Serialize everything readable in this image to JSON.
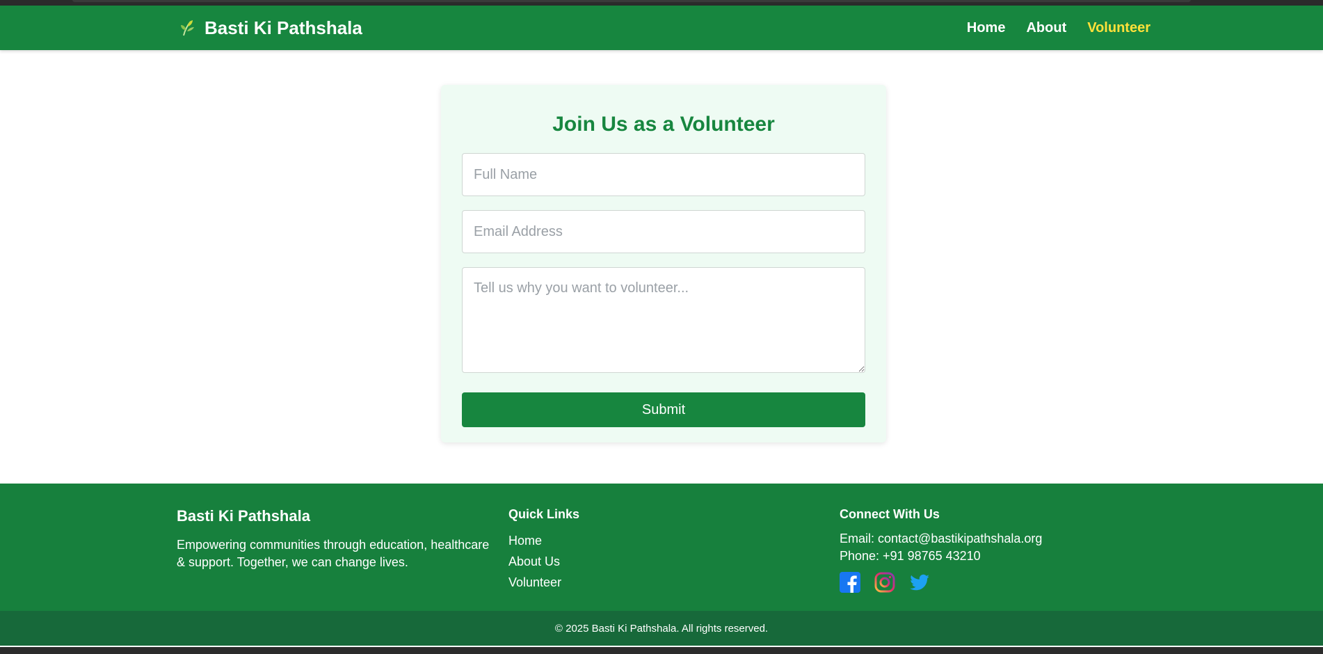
{
  "brand": {
    "name": "Basti Ki Pathshala",
    "icon": "leaf-icon"
  },
  "nav": {
    "items": [
      {
        "label": "Home"
      },
      {
        "label": "About"
      },
      {
        "label": "Volunteer"
      }
    ],
    "active": "Volunteer",
    "active_color": "#ffe13a"
  },
  "form": {
    "title": "Join Us as a Volunteer",
    "name_placeholder": "Full Name",
    "email_placeholder": "Email Address",
    "message_placeholder": "Tell us why you want to volunteer...",
    "submit_label": "Submit"
  },
  "footer": {
    "brand": "Basti Ki Pathshala",
    "description": "Empowering communities through education, healthcare & support. Together, we can change lives.",
    "quick_links_heading": "Quick Links",
    "quick_links": [
      {
        "label": "Home"
      },
      {
        "label": "About Us"
      },
      {
        "label": "Volunteer"
      }
    ],
    "connect_heading": "Connect With Us",
    "email_line": "Email: contact@bastikipathshala.org",
    "phone_line": "Phone: +91 98765 43210",
    "socials": [
      "facebook-icon",
      "instagram-icon",
      "twitter-icon"
    ],
    "copyright": "© 2025 Basti Ki Pathshala. All rights reserved."
  },
  "colors": {
    "primary_green": "#17863f",
    "footer_green": "#17803d",
    "bottom_bar_green": "#17693a",
    "card_bg": "#eefbf3"
  }
}
